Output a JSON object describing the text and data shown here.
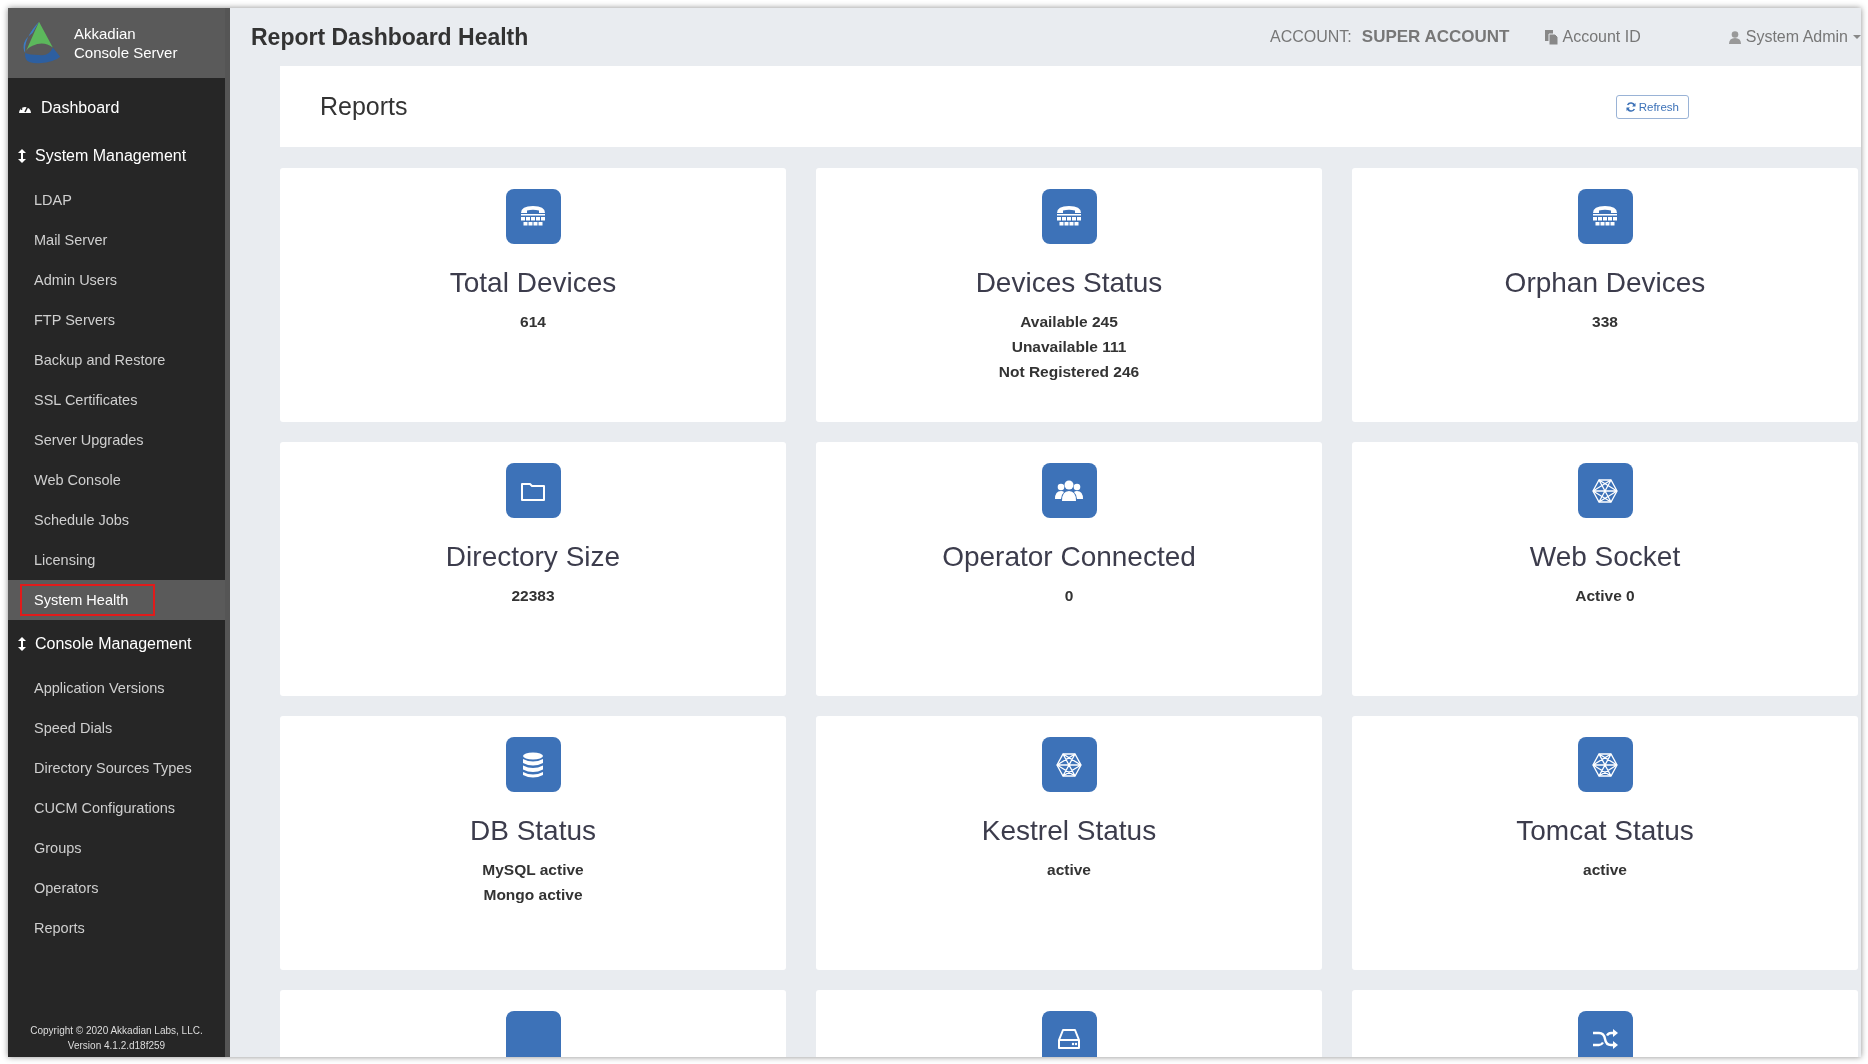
{
  "brand": {
    "line1": "Akkadian",
    "line2": "Console Server"
  },
  "sidebar": {
    "items": [
      {
        "label": "Dashboard",
        "kind": "dashboard",
        "selected": false
      },
      {
        "label": "System Management",
        "kind": "section",
        "children": [
          {
            "label": "LDAP",
            "selected": false
          },
          {
            "label": "Mail Server",
            "selected": false
          },
          {
            "label": "Admin Users",
            "selected": false
          },
          {
            "label": "FTP Servers",
            "selected": false
          },
          {
            "label": "Backup and Restore",
            "selected": false
          },
          {
            "label": "SSL Certificates",
            "selected": false
          },
          {
            "label": "Server Upgrades",
            "selected": false
          },
          {
            "label": "Web Console",
            "selected": false
          },
          {
            "label": "Schedule Jobs",
            "selected": false
          },
          {
            "label": "Licensing",
            "selected": false
          },
          {
            "label": "System Health",
            "selected": true
          }
        ]
      },
      {
        "label": "Console Management",
        "kind": "section",
        "children": [
          {
            "label": "Application Versions",
            "selected": false
          },
          {
            "label": "Speed Dials",
            "selected": false
          },
          {
            "label": "Directory Sources Types",
            "selected": false
          },
          {
            "label": "CUCM Configurations",
            "selected": false
          },
          {
            "label": "Groups",
            "selected": false
          },
          {
            "label": "Operators",
            "selected": false
          },
          {
            "label": "Reports",
            "selected": false
          }
        ]
      }
    ],
    "copyright": "Copyright © 2020 Akkadian Labs, LLC.",
    "version": "Version 4.1.2.d18f259"
  },
  "header": {
    "title": "Report Dashboard Health",
    "account_label": "ACCOUNT:",
    "account_value": "SUPER ACCOUNT",
    "account_id": "Account ID",
    "user": "System Admin"
  },
  "panel": {
    "title": "Reports",
    "refresh": "Refresh"
  },
  "cards": [
    {
      "kind": "phone",
      "title": "Total Devices",
      "lines": [
        "614"
      ]
    },
    {
      "kind": "phone",
      "title": "Devices Status",
      "lines": [
        "Available 245",
        "Unavailable 111",
        "Not Registered 246"
      ]
    },
    {
      "kind": "phone",
      "title": "Orphan Devices",
      "lines": [
        "338"
      ]
    },
    {
      "kind": "folder",
      "title": "Directory Size",
      "lines": [
        "22383"
      ]
    },
    {
      "kind": "users",
      "title": "Operator Connected",
      "lines": [
        "0"
      ]
    },
    {
      "kind": "hexagon",
      "title": "Web Socket",
      "lines": [
        "Active 0"
      ]
    },
    {
      "kind": "database",
      "title": "DB Status",
      "lines": [
        "MySQL active",
        "Mongo active"
      ]
    },
    {
      "kind": "hexagon",
      "title": "Kestrel Status",
      "lines": [
        "active"
      ]
    },
    {
      "kind": "hexagon",
      "title": "Tomcat Status",
      "lines": [
        "active"
      ]
    },
    {
      "kind": "blank"
    },
    {
      "kind": "drive"
    },
    {
      "kind": "shuffle"
    }
  ]
}
